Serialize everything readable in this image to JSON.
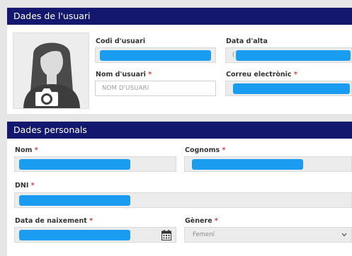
{
  "account_panel": {
    "title": "Dades de l'usuari",
    "user_code_label": "Codi d'usuari",
    "signup_date_label": "Data d'alta",
    "signup_date_partial": "(",
    "username_label": "Nom d'usuari",
    "username_placeholder": "NOM D'USUARI",
    "email_label": "Correu electrònic"
  },
  "personal_panel": {
    "title": "Dades personals",
    "name_label": "Nom",
    "surname_label": "Cognoms",
    "dni_label": "DNI",
    "birthdate_label": "Data de naixement",
    "gender_label": "Gènere",
    "gender_value": "Femení"
  },
  "required_mark": "*",
  "icons": [
    "user-avatar-icon",
    "camera-icon",
    "calendar-icon",
    "chevron-down-icon"
  ],
  "colors": {
    "header_bg": "#13176e",
    "required": "#d9403a",
    "redaction": "#1a9df0"
  }
}
